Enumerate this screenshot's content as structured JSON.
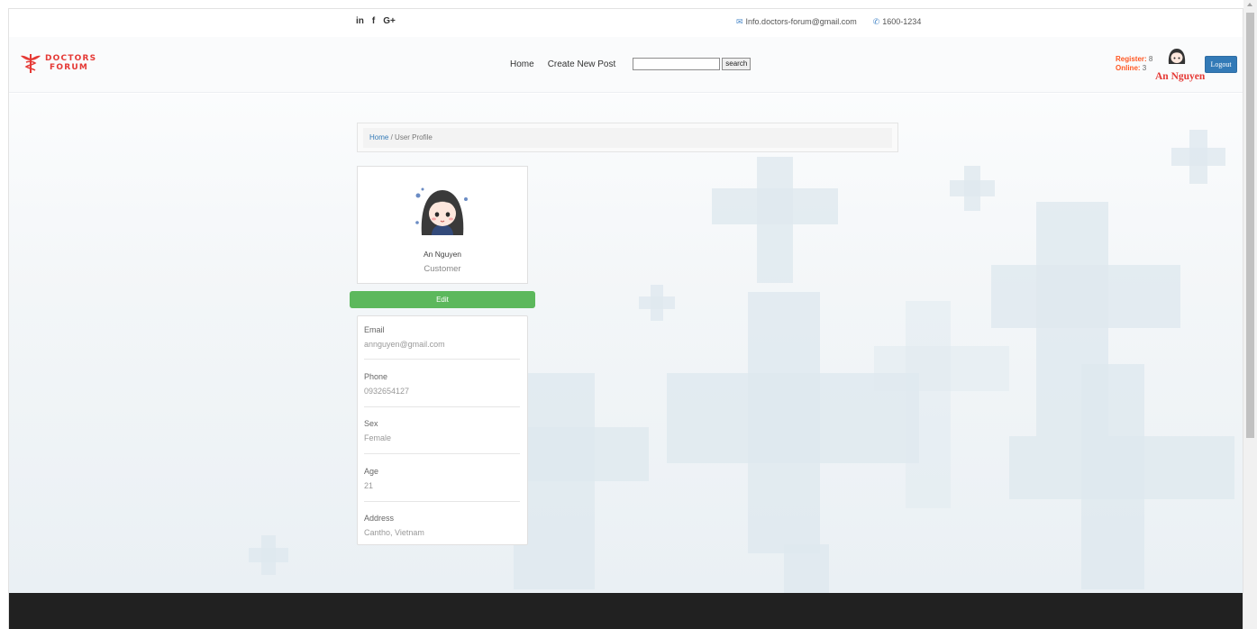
{
  "topbar": {
    "social": [
      "in",
      "f",
      "G+"
    ],
    "email": "Info.doctors-forum@gmail.com",
    "phone": "1600-1234"
  },
  "brand": {
    "line1": "DOCTORS",
    "line2": "FORUM"
  },
  "nav": {
    "home": "Home",
    "create_post": "Create New Post",
    "search_value": "",
    "search_button": "search"
  },
  "stats": {
    "register_label": "Register:",
    "register_value": "8",
    "online_label": "Online:",
    "online_value": "3"
  },
  "user": {
    "header_name": "An Nguyen",
    "logout": "Logout"
  },
  "breadcrumb": {
    "home": "Home",
    "separator": "/",
    "current": "User Profile"
  },
  "profile": {
    "name": "An Nguyen",
    "role": "Customer",
    "edit_label": "Edit",
    "fields": [
      {
        "label": "Email",
        "value": "annguyen@gmail.com"
      },
      {
        "label": "Phone",
        "value": "0932654127"
      },
      {
        "label": "Sex",
        "value": "Female"
      },
      {
        "label": "Age",
        "value": "21"
      },
      {
        "label": "Address",
        "value": "Cantho, Vietnam"
      }
    ]
  },
  "colors": {
    "brand_red": "#e53935",
    "stats_orange": "#ff5722",
    "logout_blue": "#337ab7",
    "edit_green": "#5cb85c",
    "footer_dark": "#212121"
  }
}
